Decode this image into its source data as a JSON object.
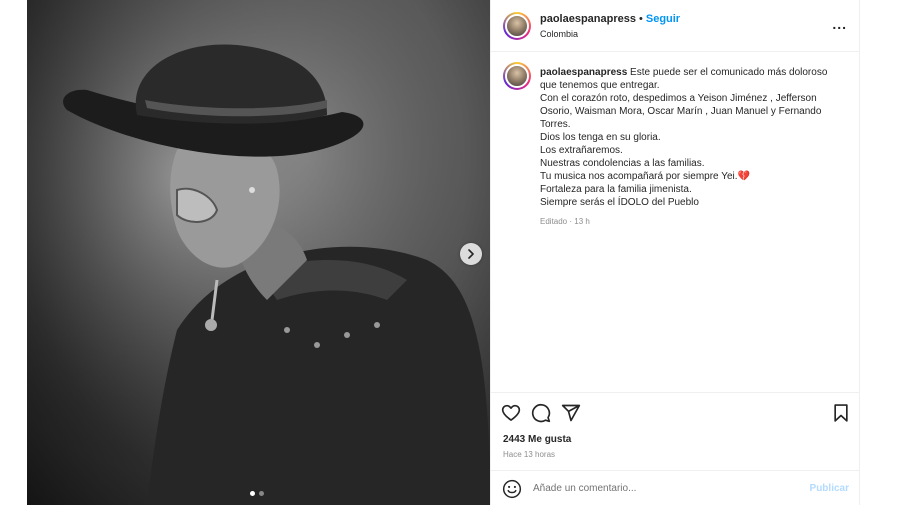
{
  "post": {
    "image_alt": "Black and white photo of a man in a cowboy hat looking down",
    "carousel": {
      "total": 2,
      "current": 1
    }
  },
  "header": {
    "username": "paolaespanapress",
    "separator": "•",
    "follow_label": "Seguir",
    "location": "Colombia",
    "more_label": "..."
  },
  "caption": {
    "username": "paolaespanapress",
    "lines": [
      "Este puede ser el comunicado más doloroso",
      "que tenemos que entregar.",
      "Con el corazón roto, despedimos a Yeison Jiménez , Jefferson",
      "Osorio, Waisman Mora, Oscar Marín , Juan Manuel y Fernando",
      "Torres.",
      "Dios los tenga en su gloria.",
      "Los extrañaremos.",
      "Nuestras condolencias a las familias.",
      "Tu musica nos acompañará por siempre Yei.",
      "Fortaleza para la familia jimenista.",
      "Siempre serás el ÍDOLO del Pueblo"
    ],
    "emoji": "💔",
    "edited": "Editado · 13 h"
  },
  "actions": {
    "icons": [
      "heart-icon",
      "comment-icon",
      "share-icon",
      "bookmark-icon"
    ],
    "likes": "2443 Me gusta",
    "time": "Hace 13 horas"
  },
  "comment": {
    "placeholder": "Añade un comentario...",
    "publish_label": "Publicar"
  },
  "colors": {
    "accent": "#0095f6",
    "publish_disabled": "#b3dbff",
    "text": "#262626",
    "muted": "#8e8e8e"
  }
}
